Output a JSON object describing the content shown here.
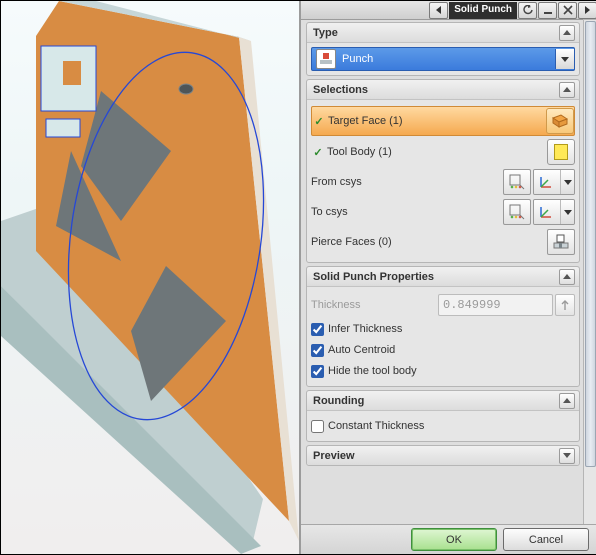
{
  "header": {
    "title": "Solid Punch"
  },
  "sections": {
    "type": {
      "title": "Type",
      "value": "Punch"
    },
    "selections": {
      "title": "Selections",
      "target_face": "Target Face (1)",
      "tool_body": "Tool Body (1)",
      "from_csys": "From csys",
      "to_csys": "To csys",
      "pierce_faces": "Pierce Faces (0)"
    },
    "properties": {
      "title": "Solid Punch Properties",
      "thickness_label": "Thickness",
      "thickness_value": "0.849999",
      "infer_thickness": "Infer Thickness",
      "auto_centroid": "Auto Centroid",
      "hide_tool_body": "Hide the tool body"
    },
    "rounding": {
      "title": "Rounding",
      "constant_thickness": "Constant Thickness"
    },
    "preview": {
      "title": "Preview"
    }
  },
  "footer": {
    "ok": "OK",
    "cancel": "Cancel"
  }
}
